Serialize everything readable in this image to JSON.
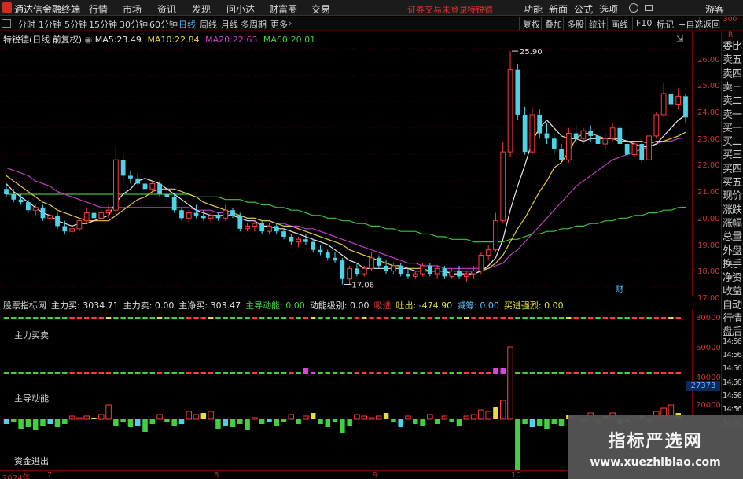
{
  "menubar": {
    "app_title": "通达信金融终端",
    "items": [
      "行情",
      "市场",
      "资讯",
      "发现",
      "问小达",
      "财富圈",
      "交易"
    ],
    "notice": "证券交易未登录",
    "stock_name": "特锐德",
    "right_items": [
      "功能",
      "新面",
      "公式",
      "选项",
      "游客"
    ]
  },
  "toolbar": {
    "tabs": [
      "分时",
      "1分钟",
      "5分钟",
      "15分钟",
      "30分钟",
      "60分钟",
      "日线",
      "周线",
      "月线",
      "多周期",
      "更多"
    ],
    "active_tab": "日线",
    "right_tabs": [
      "复权",
      "叠加",
      "多股",
      "统计",
      "画线",
      "F10",
      "标记",
      "+自选",
      "返回"
    ]
  },
  "main_chart": {
    "title": "特锐德(日线 前复权)",
    "ma": [
      {
        "label": "MA5:",
        "value": "23.49",
        "color": "#e8e8e8"
      },
      {
        "label": "MA10:",
        "value": "22.84",
        "color": "#e8d040"
      },
      {
        "label": "MA20:",
        "value": "22.63",
        "color": "#d040d0"
      },
      {
        "label": "MA60:",
        "value": "20.01",
        "color": "#40d040"
      }
    ],
    "y_ticks": [
      "26.00",
      "25.00",
      "24.00",
      "23.00",
      "22.00",
      "21.00",
      "20.00",
      "19.00",
      "18.00",
      "17.00"
    ],
    "high_label": "25.90",
    "low_label": "17.06",
    "event_marker": "财"
  },
  "indicator": {
    "header": [
      {
        "text": "股票指标网",
        "color": "#d0d0d0"
      },
      {
        "text": "主力买: 3034.71",
        "color": "#e0e0e0"
      },
      {
        "text": "主力卖: 0.00",
        "color": "#e0e0e0"
      },
      {
        "text": "主净买: 303.47",
        "color": "#e0e0e0"
      },
      {
        "text": "主导动能: 0.00",
        "color": "#40d040"
      },
      {
        "text": "动能级别: 0.00",
        "color": "#e0e0e0"
      },
      {
        "text": "吸进",
        "color": "#e03030"
      },
      {
        "text": "吐出: -474.90",
        "color": "#e0e040"
      },
      {
        "text": "减筹: 0.00",
        "color": "#5ec0ff"
      },
      {
        "text": "买进强烈: 0.00",
        "color": "#e0e040"
      }
    ],
    "labels": [
      "主力买卖",
      "主导动能",
      "资金进出"
    ],
    "y_ticks": [
      "80000",
      "60000",
      "40000",
      "20000"
    ],
    "value_badge": "27373"
  },
  "x_axis": {
    "labels": [
      "2024年",
      "7",
      "8",
      "9",
      "10"
    ]
  },
  "sidebar": {
    "top_labels": [
      "R",
      "300"
    ],
    "items": [
      "委比",
      "卖五",
      "卖四",
      "卖三",
      "卖二",
      "卖一",
      "买一",
      "买二",
      "买三",
      "买四",
      "买五",
      "现价",
      "涨跌",
      "涨幅",
      "总量",
      "外盘",
      "换手",
      "净资",
      "收益",
      "自动",
      "行情",
      "盘后",
      "14:56",
      "14:56",
      "14:56",
      "14:56",
      "14:56",
      "14:56",
      "14:56"
    ]
  },
  "watermark": {
    "title": "指标严选网",
    "url": "www.xuezhibiao.com"
  },
  "chart_data": {
    "type": "candlestick",
    "ylim": [
      16.7,
      26.2
    ],
    "candles": [
      [
        20.7,
        20.9,
        20.4,
        20.5
      ],
      [
        20.5,
        20.7,
        20.2,
        20.3
      ],
      [
        20.3,
        20.5,
        20.1,
        20.2
      ],
      [
        20.2,
        20.3,
        19.8,
        19.9
      ],
      [
        19.9,
        20.1,
        19.7,
        20.0
      ],
      [
        20.0,
        20.1,
        19.5,
        19.6
      ],
      [
        19.6,
        19.8,
        19.4,
        19.7
      ],
      [
        19.7,
        19.8,
        19.2,
        19.3
      ],
      [
        19.3,
        19.5,
        19.0,
        19.1
      ],
      [
        19.1,
        19.3,
        18.9,
        19.2
      ],
      [
        19.2,
        19.6,
        19.1,
        19.5
      ],
      [
        19.5,
        20.0,
        19.4,
        19.8
      ],
      [
        19.8,
        19.9,
        19.5,
        19.6
      ],
      [
        19.6,
        19.9,
        19.5,
        19.8
      ],
      [
        19.8,
        20.1,
        19.6,
        19.9
      ],
      [
        19.9,
        22.3,
        19.8,
        21.8
      ],
      [
        21.8,
        22.0,
        21.0,
        21.2
      ],
      [
        21.2,
        21.4,
        20.9,
        21.1
      ],
      [
        21.1,
        21.3,
        20.8,
        20.9
      ],
      [
        20.9,
        21.2,
        20.6,
        20.7
      ],
      [
        20.7,
        21.0,
        20.6,
        20.9
      ],
      [
        20.9,
        21.0,
        20.4,
        20.5
      ],
      [
        20.5,
        20.7,
        20.2,
        20.4
      ],
      [
        20.4,
        20.5,
        19.8,
        19.9
      ],
      [
        19.9,
        20.0,
        19.5,
        19.6
      ],
      [
        19.6,
        19.9,
        19.4,
        19.8
      ],
      [
        19.8,
        20.1,
        19.6,
        19.7
      ],
      [
        19.7,
        19.9,
        19.5,
        19.6
      ],
      [
        19.6,
        19.8,
        19.4,
        19.7
      ],
      [
        19.7,
        19.8,
        19.5,
        19.6
      ],
      [
        19.6,
        20.1,
        19.5,
        19.9
      ],
      [
        19.9,
        20.0,
        19.6,
        19.7
      ],
      [
        19.7,
        19.8,
        19.1,
        19.2
      ],
      [
        19.2,
        19.4,
        19.1,
        19.3
      ],
      [
        19.3,
        19.5,
        19.1,
        19.4
      ],
      [
        19.4,
        19.5,
        19.0,
        19.1
      ],
      [
        19.1,
        19.4,
        19.0,
        19.3
      ],
      [
        19.3,
        19.4,
        19.0,
        19.1
      ],
      [
        19.1,
        19.2,
        18.8,
        18.9
      ],
      [
        18.9,
        19.0,
        18.6,
        18.7
      ],
      [
        18.7,
        18.9,
        18.5,
        18.8
      ],
      [
        18.8,
        19.0,
        18.6,
        18.7
      ],
      [
        18.7,
        18.8,
        18.3,
        18.4
      ],
      [
        18.4,
        18.6,
        18.2,
        18.3
      ],
      [
        18.3,
        18.4,
        18.0,
        18.1
      ],
      [
        18.1,
        18.3,
        17.9,
        18.0
      ],
      [
        18.0,
        18.1,
        17.1,
        17.3
      ],
      [
        17.3,
        17.8,
        17.1,
        17.7
      ],
      [
        17.7,
        17.9,
        17.4,
        17.5
      ],
      [
        17.5,
        17.8,
        17.4,
        17.7
      ],
      [
        17.7,
        18.3,
        17.6,
        18.1
      ],
      [
        18.1,
        18.2,
        17.7,
        17.8
      ],
      [
        17.8,
        18.0,
        17.5,
        17.6
      ],
      [
        17.6,
        17.9,
        17.5,
        17.8
      ],
      [
        17.8,
        17.9,
        17.4,
        17.5
      ],
      [
        17.5,
        17.7,
        17.3,
        17.4
      ],
      [
        17.4,
        17.6,
        17.3,
        17.5
      ],
      [
        17.5,
        17.9,
        17.4,
        17.8
      ],
      [
        17.8,
        17.9,
        17.4,
        17.5
      ],
      [
        17.5,
        17.8,
        17.3,
        17.7
      ],
      [
        17.7,
        17.8,
        17.3,
        17.4
      ],
      [
        17.4,
        17.7,
        17.3,
        17.6
      ],
      [
        17.6,
        17.8,
        17.3,
        17.4
      ],
      [
        17.4,
        17.6,
        17.2,
        17.5
      ],
      [
        17.5,
        17.8,
        17.3,
        17.6
      ],
      [
        17.6,
        18.3,
        17.5,
        18.2
      ],
      [
        18.2,
        18.6,
        18.0,
        18.4
      ],
      [
        18.4,
        19.8,
        18.3,
        19.5
      ],
      [
        19.5,
        22.5,
        19.4,
        22.1
      ],
      [
        22.1,
        25.9,
        21.9,
        25.2
      ],
      [
        25.2,
        25.4,
        23.3,
        23.5
      ],
      [
        23.5,
        23.8,
        22.0,
        22.1
      ],
      [
        22.1,
        23.8,
        22.0,
        23.5
      ],
      [
        23.5,
        23.7,
        22.6,
        22.8
      ],
      [
        22.8,
        23.2,
        22.4,
        22.6
      ],
      [
        22.6,
        22.8,
        22.0,
        22.2
      ],
      [
        22.2,
        22.4,
        21.7,
        21.8
      ],
      [
        21.8,
        23.0,
        21.7,
        22.8
      ],
      [
        22.8,
        23.1,
        22.4,
        22.6
      ],
      [
        22.6,
        23.0,
        22.4,
        22.9
      ],
      [
        22.9,
        23.1,
        22.5,
        22.7
      ],
      [
        22.7,
        22.9,
        22.3,
        22.4
      ],
      [
        22.4,
        22.8,
        22.2,
        22.6
      ],
      [
        22.6,
        23.2,
        22.5,
        23.0
      ],
      [
        23.0,
        23.1,
        22.3,
        22.4
      ],
      [
        22.4,
        22.6,
        21.9,
        22.0
      ],
      [
        22.0,
        22.5,
        21.9,
        22.4
      ],
      [
        22.4,
        22.6,
        21.7,
        21.8
      ],
      [
        21.8,
        22.9,
        21.7,
        22.7
      ],
      [
        22.7,
        23.6,
        22.6,
        23.5
      ],
      [
        23.5,
        24.7,
        23.4,
        24.3
      ],
      [
        24.3,
        24.5,
        23.8,
        23.9
      ],
      [
        23.9,
        24.5,
        23.7,
        24.2
      ],
      [
        24.2,
        24.3,
        23.2,
        23.4
      ]
    ],
    "ma5": [
      20.9,
      20.6,
      20.4,
      20.2,
      20.0,
      19.8,
      19.7,
      19.5,
      19.4,
      19.3,
      19.4,
      19.4,
      19.5,
      19.6,
      19.7,
      20.2,
      20.5,
      20.7,
      21.0,
      21.1,
      21.0,
      20.9,
      20.7,
      20.5,
      20.3,
      20.1,
      19.9,
      19.8,
      19.7,
      19.7,
      19.7,
      19.7,
      19.6,
      19.5,
      19.5,
      19.3,
      19.3,
      19.2,
      19.2,
      19.1,
      19.0,
      18.9,
      18.8,
      18.7,
      18.6,
      18.4,
      18.2,
      18.0,
      17.9,
      17.7,
      17.7,
      17.7,
      17.7,
      17.7,
      17.7,
      17.7,
      17.6,
      17.6,
      17.6,
      17.6,
      17.6,
      17.5,
      17.5,
      17.5,
      17.5,
      17.6,
      17.8,
      18.1,
      18.8,
      19.9,
      20.8,
      21.6,
      22.5,
      23.0,
      23.3,
      23.0,
      22.7,
      22.6,
      22.6,
      22.5,
      22.6,
      22.6,
      22.6,
      22.6,
      22.6,
      22.5,
      22.4,
      22.3,
      22.3,
      22.4,
      22.7,
      23.0,
      23.3,
      23.49
    ],
    "ma10": [
      21.2,
      21.0,
      20.8,
      20.6,
      20.4,
      20.2,
      20.1,
      19.9,
      19.8,
      19.7,
      19.6,
      19.5,
      19.5,
      19.5,
      19.5,
      19.7,
      19.9,
      20.1,
      20.3,
      20.4,
      20.6,
      20.7,
      20.7,
      20.7,
      20.6,
      20.5,
      20.4,
      20.2,
      20.1,
      20.0,
      19.9,
      19.8,
      19.7,
      19.6,
      19.6,
      19.5,
      19.5,
      19.4,
      19.3,
      19.3,
      19.2,
      19.1,
      19.0,
      18.9,
      18.8,
      18.7,
      18.6,
      18.4,
      18.3,
      18.2,
      18.1,
      18.0,
      17.9,
      17.8,
      17.8,
      17.7,
      17.7,
      17.7,
      17.6,
      17.6,
      17.6,
      17.6,
      17.6,
      17.6,
      17.6,
      17.6,
      17.7,
      17.9,
      18.2,
      18.7,
      19.2,
      19.6,
      20.1,
      20.6,
      21.0,
      21.5,
      21.7,
      22.1,
      22.6,
      22.8,
      22.8,
      22.7,
      22.6,
      22.6,
      22.5,
      22.5,
      22.5,
      22.5,
      22.4,
      22.5,
      22.5,
      22.6,
      22.7,
      22.84
    ],
    "ma20": [
      21.5,
      21.4,
      21.3,
      21.2,
      21.0,
      20.9,
      20.8,
      20.6,
      20.5,
      20.4,
      20.3,
      20.2,
      20.1,
      20.0,
      20.0,
      20.0,
      20.0,
      20.0,
      20.0,
      20.0,
      20.0,
      20.0,
      20.0,
      20.0,
      20.0,
      20.0,
      19.9,
      19.9,
      19.9,
      19.8,
      19.8,
      19.7,
      19.7,
      19.6,
      19.6,
      19.5,
      19.5,
      19.4,
      19.4,
      19.3,
      19.3,
      19.2,
      19.2,
      19.1,
      19.0,
      18.9,
      18.8,
      18.7,
      18.6,
      18.5,
      18.4,
      18.3,
      18.2,
      18.1,
      18.0,
      17.9,
      17.9,
      17.8,
      17.8,
      17.8,
      17.7,
      17.7,
      17.7,
      17.7,
      17.7,
      17.7,
      17.7,
      17.8,
      17.9,
      18.2,
      18.4,
      18.7,
      19.0,
      19.3,
      19.6,
      19.9,
      20.2,
      20.5,
      20.8,
      21.0,
      21.2,
      21.4,
      21.6,
      21.8,
      21.9,
      22.0,
      22.1,
      22.2,
      22.3,
      22.4,
      22.5,
      22.5,
      22.6,
      22.63
    ],
    "ma60": [
      20.5,
      20.5,
      20.5,
      20.5,
      20.5,
      20.5,
      20.5,
      20.5,
      20.5,
      20.5,
      20.5,
      20.5,
      20.5,
      20.5,
      20.5,
      20.5,
      20.5,
      20.5,
      20.5,
      20.5,
      20.5,
      20.5,
      20.5,
      20.5,
      20.5,
      20.5,
      20.4,
      20.4,
      20.4,
      20.4,
      20.3,
      20.3,
      20.3,
      20.2,
      20.2,
      20.1,
      20.1,
      20.0,
      20.0,
      19.9,
      19.9,
      19.8,
      19.7,
      19.7,
      19.6,
      19.6,
      19.5,
      19.5,
      19.4,
      19.4,
      19.3,
      19.3,
      19.2,
      19.2,
      19.1,
      19.1,
      19.1,
      19.0,
      19.0,
      18.9,
      18.9,
      18.8,
      18.8,
      18.8,
      18.7,
      18.7,
      18.7,
      18.7,
      18.7,
      18.8,
      18.8,
      18.9,
      19.0,
      19.0,
      19.1,
      19.1,
      19.2,
      19.2,
      19.3,
      19.3,
      19.4,
      19.4,
      19.5,
      19.5,
      19.6,
      19.6,
      19.7,
      19.7,
      19.8,
      19.8,
      19.9,
      19.9,
      20.0,
      20.01
    ],
    "momentum_bars": [
      -0.3,
      -0.2,
      -0.6,
      -0.5,
      -0.7,
      -0.4,
      -0.3,
      -0.5,
      -0.3,
      0.2,
      0.1,
      0.2,
      0.1,
      0.3,
      0.9,
      -0.4,
      -0.2,
      -0.5,
      -0.4,
      -0.8,
      -0.3,
      0.3,
      -0.2,
      -0.4,
      -0.3,
      0.5,
      0.3,
      0.4,
      0.5,
      -0.6,
      -0.4,
      -0.5,
      -0.3,
      -0.7,
      0.1,
      -0.3,
      -0.2,
      -0.4,
      -0.2,
      0.3,
      -0.3,
      0.2,
      0.4,
      -0.3,
      -0.5,
      -0.2,
      -0.9,
      -0.4,
      0.3,
      0.2,
      0.1,
      0.2,
      0.4,
      -0.2,
      -0.5,
      0.2,
      -0.3,
      -0.4,
      0.3,
      -0.3,
      0.2,
      -0.2,
      -0.4,
      0.2,
      0.3,
      0.6,
      0.5,
      0.8,
      1.2,
      2.7,
      -3.3,
      -0.3,
      -0.5,
      -0.4,
      -0.6,
      -0.3,
      -0.4,
      0.3,
      0.2,
      -0.2,
      0.4,
      -0.3,
      0.2,
      0.4,
      -0.3,
      -0.2,
      0.2,
      0.3,
      -0.2,
      0.5,
      0.7,
      0.9,
      0.4
    ]
  }
}
